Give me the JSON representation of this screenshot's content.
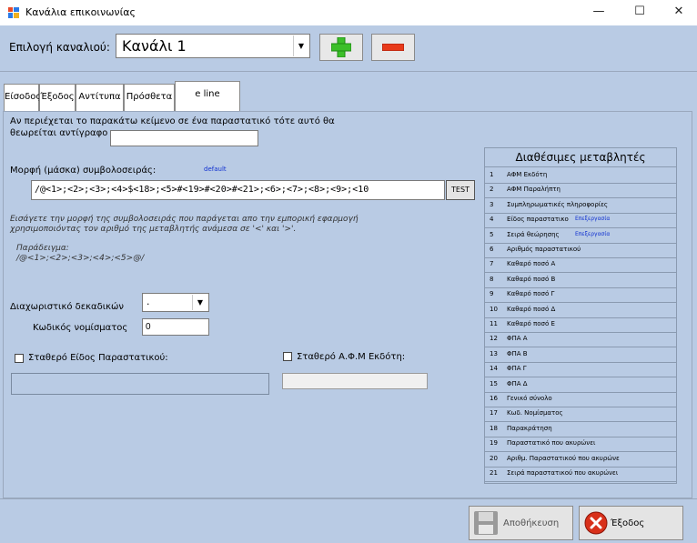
{
  "window": {
    "title": "Κανάλια επικοινωνίας",
    "minimize": "—",
    "maximize": "☐",
    "close": "✕"
  },
  "channel": {
    "label": "Επιλογή καναλιού:",
    "selected": "Κανάλι 1"
  },
  "tabs": [
    "Είσοδος",
    "Έξοδος",
    "Αντίτυπα",
    "Πρόσθετα",
    "e line"
  ],
  "copy": {
    "line1": "Αν περιέχεται το παρακάτω κείμενο σε ένα παραστατικό τότε αυτό θα",
    "line2": "θεωρείται αντίγραφο",
    "value": ""
  },
  "mask": {
    "label": "Μορφή (μάσκα) συμβολοσειράς:",
    "default_link": "default",
    "value": "/@<1>;<2>;<3>;<4>$<18>;<5>#<19>#<20>#<21>;<6>;<7>;<8>;<9>;<10",
    "test_button": "TEST",
    "help1": "Εισάγετε την μορφή της συμβολοσειράς που παράγεται απο την εμπορική εφαρμογή",
    "help2": "χρησιμοποιόντας τον αριθμό της μεταβλητής ανάμεσα σε '<' και '>'.",
    "example_label": "Παράδειγμα:",
    "example_value": "/@<1>;<2>;<3>;<4>;<5>@/"
  },
  "decimal": {
    "label": "Διαχωριστικό δεκαδικών",
    "value": "."
  },
  "currency": {
    "label": "Κωδικός νομίσματος",
    "value": "0"
  },
  "fixed_type": {
    "label": "Σταθερό Είδος Παραστατικού:",
    "checked": false,
    "value": ""
  },
  "fixed_afm": {
    "label": "Σταθερό Α.Φ.Μ Εκδότη:",
    "checked": false,
    "value": ""
  },
  "variables": {
    "title": "Διαθέσιμες μεταβλητές",
    "edit_label": "Επεξεργασία",
    "items": [
      {
        "num": "1",
        "label": "ΑΦΜ Εκδότη",
        "edit": false
      },
      {
        "num": "2",
        "label": "ΑΦΜ Παραλήπτη",
        "edit": false
      },
      {
        "num": "3",
        "label": "Συμπληρωματικές πληροφορίες",
        "edit": false
      },
      {
        "num": "4",
        "label": "Είδος παραστατικο",
        "edit": true
      },
      {
        "num": "5",
        "label": "Σειρά θεώρησης",
        "edit": true
      },
      {
        "num": "6",
        "label": "Αριθμός παραστατικού",
        "edit": false
      },
      {
        "num": "7",
        "label": "Καθαρό ποσό Α",
        "edit": false
      },
      {
        "num": "8",
        "label": "Καθαρό ποσό Β",
        "edit": false
      },
      {
        "num": "9",
        "label": "Καθαρό ποσό Γ",
        "edit": false
      },
      {
        "num": "10",
        "label": "Καθαρό ποσό Δ",
        "edit": false
      },
      {
        "num": "11",
        "label": "Καθαρό ποσό Ε",
        "edit": false
      },
      {
        "num": "12",
        "label": "ΦΠΑ Α",
        "edit": false
      },
      {
        "num": "13",
        "label": "ΦΠΑ Β",
        "edit": false
      },
      {
        "num": "14",
        "label": "ΦΠΑ Γ",
        "edit": false
      },
      {
        "num": "15",
        "label": "ΦΠΑ Δ",
        "edit": false
      },
      {
        "num": "16",
        "label": "Γενικό σύνολο",
        "edit": false
      },
      {
        "num": "17",
        "label": "Κωδ. Νομίσματος",
        "edit": false
      },
      {
        "num": "18",
        "label": "Παρακράτηση",
        "edit": false
      },
      {
        "num": "19",
        "label": "Παραστατικό που ακυρώνει",
        "edit": false
      },
      {
        "num": "20",
        "label": "Αριθμ. Παραστατικού που ακυρώνε",
        "edit": false
      },
      {
        "num": "21",
        "label": "Σειρά παραστατικού που ακυρώνει",
        "edit": false
      }
    ]
  },
  "footer": {
    "save": "Αποθήκευση",
    "exit": "Έξοδος"
  }
}
